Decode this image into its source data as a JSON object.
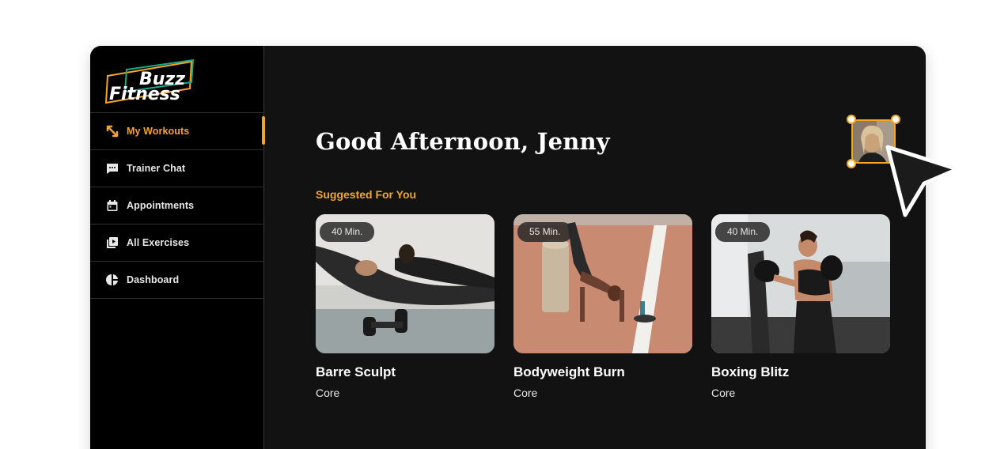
{
  "brand": {
    "line1": "Buzz",
    "line2": "Fitness",
    "accent": "#f5a623"
  },
  "sidebar": {
    "items": [
      {
        "label": "My Workouts",
        "icon": "expand-arrows-icon",
        "active": true
      },
      {
        "label": "Trainer Chat",
        "icon": "chat-bubble-icon",
        "active": false
      },
      {
        "label": "Appointments",
        "icon": "calendar-icon",
        "active": false
      },
      {
        "label": "All Exercises",
        "icon": "video-library-icon",
        "active": false
      },
      {
        "label": "Dashboard",
        "icon": "pie-chart-icon",
        "active": false
      }
    ]
  },
  "main": {
    "greeting": "Good Afternoon, Jenny",
    "section_title": "Suggested For You",
    "avatar": {
      "icon": "user-avatar"
    },
    "workouts": [
      {
        "duration": "40 Min.",
        "title": "Barre Sculpt",
        "category": "Core"
      },
      {
        "duration": "55 Min.",
        "title": "Bodyweight Burn",
        "category": "Core"
      },
      {
        "duration": "40 Min.",
        "title": "Boxing Blitz",
        "category": "Core"
      }
    ]
  },
  "cursor": {
    "icon": "mouse-pointer-icon"
  }
}
